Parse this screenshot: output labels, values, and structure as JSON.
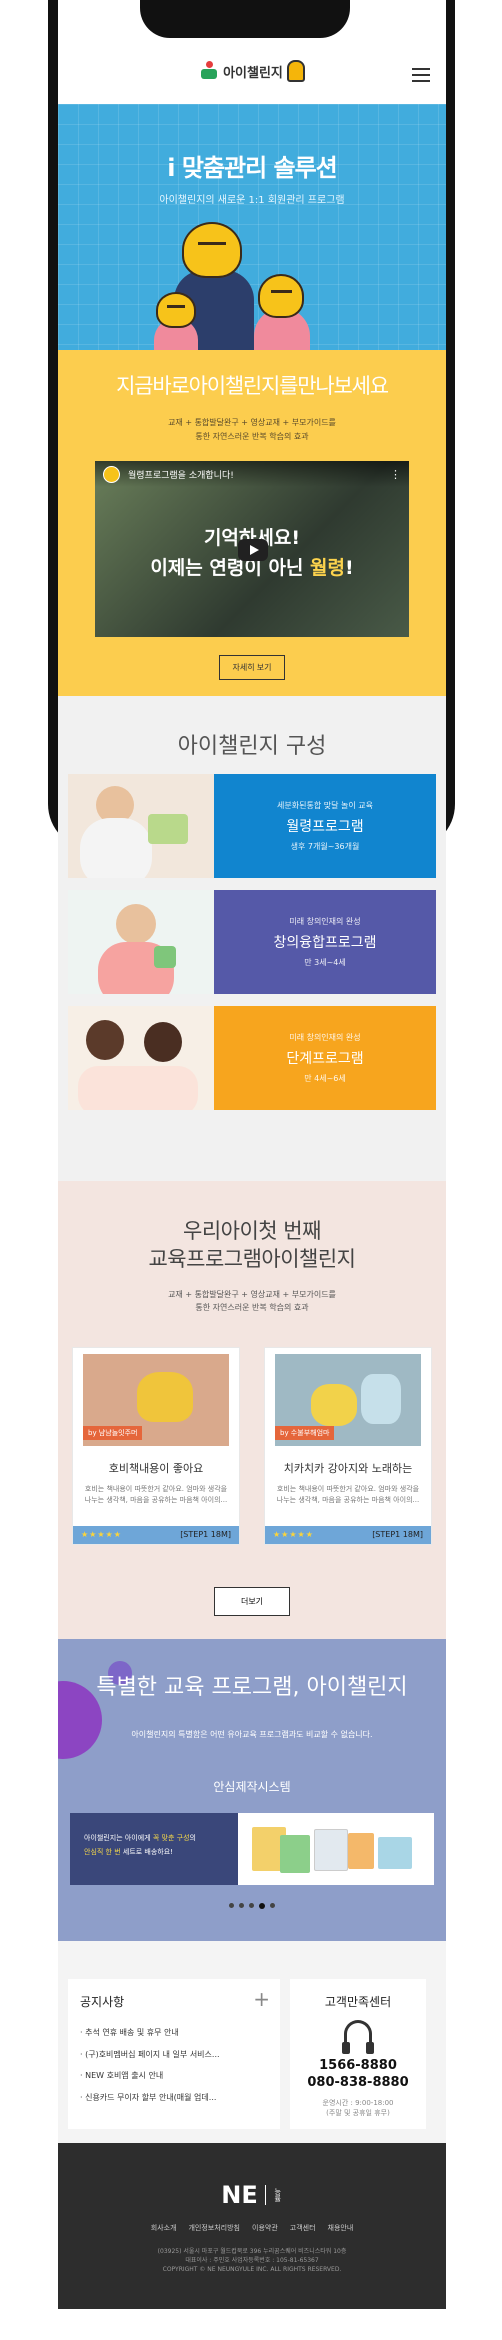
{
  "header": {
    "logo_text": "아이챌린지"
  },
  "hero": {
    "title": "i 맞춤관리 솔루션",
    "subtitle": "아이챌린지의 새로운 1:1 회원관리 프로그램"
  },
  "intro": {
    "title": "지금바로아이챌린지를만나보세요",
    "sub_line1": "교재 + 통합발달완구 + 영상교재 + 부모가이드를",
    "sub_line2": "통한 자연스러운 반복 학습의 효과",
    "video": {
      "title": "월령프로그램을 소개합니다!",
      "line1": "기억하세요!",
      "line2_prefix": "이제는 연령이 아닌 ",
      "line2_highlight": "월령",
      "line2_suffix": "!"
    },
    "detail_button": "자세히 보기"
  },
  "composition": {
    "title": "아이챌린지 구성",
    "programs": [
      {
        "small": "세분화된통합 맞달 놀이 교육",
        "name": "월령프로그램",
        "age": "생후 7개월~36개월",
        "color": "#1185cf"
      },
      {
        "small": "미래 창의인재의 완성",
        "name": "창의융합프로그램",
        "age": "만 3세~4세",
        "color": "#5559a8"
      },
      {
        "small": "미래 창의인재의 완성",
        "name": "단계프로그램",
        "age": "만 4세~6세",
        "color": "#f7a51e"
      }
    ]
  },
  "first_program": {
    "title_line1": "우리아이첫 번째",
    "title_line2": "교육프로그램아이챌린지",
    "sub_line1": "교재 + 통합발달완구 + 영상교재 + 부모가이드를",
    "sub_line2": "통한 자연스러운 반복 학습의 효과",
    "cards": [
      {
        "tag": "by 냠냠놀잇주머",
        "title": "호비책내용이 좋아요",
        "desc": "호비는 책내용이 따뜻한거 같아요. 엄마와 생각을 나누는 생각책, 마음을 공유하는 마음책 아이의...",
        "stars": "★★★★★",
        "step": "[STEP1 18M]"
      },
      {
        "tag": "by 수불부해엄마",
        "title": "치카치카 강아지와 노래하는",
        "desc": "호비는 책내용이 따뜻한거 같아요. 엄마와 생각을 나누는 생각책, 마음을 공유하는 마음책 아이의...",
        "stars": "★★★★★",
        "step": "[STEP1 18M]"
      }
    ],
    "more_button": "더보기"
  },
  "special": {
    "title": "특별한 교육 프로그램, 아이챌린지",
    "sub": "아이챌린지의 특별함은 어떤 유아교육 프로그램과도 비교할 수 없습니다.",
    "system_title": "안심제작시스템",
    "banner_line1_prefix": "아이챌린지는 아이에게 ",
    "banner_line1_highlight": "꼭 맞춘 구성",
    "banner_line1_suffix": "의",
    "banner_line2_highlight": "안심직 한 번",
    "banner_line2_suffix": " 세트로 배송하요!"
  },
  "notice": {
    "title": "공지사항",
    "items": [
      "· 추석 연휴 배송 및 휴무 안내",
      "· (구)호비멤버십 페이지 내 일부 서비스...",
      "· NEW 호비앱 출시 안내",
      "· 신용카드 무이자 할부 안내(매월 업데..."
    ]
  },
  "customer_center": {
    "title": "고객만족센터",
    "phone1": "1566-8880",
    "phone2": "080-838-8880",
    "hours1": "운영시간 : 9:00-18:00",
    "hours2": "(주말 및 공휴일 휴무)"
  },
  "footer": {
    "logo": "NE",
    "brand": "능률",
    "links": [
      "회사소개",
      "개인정보처리방침",
      "이용약관",
      "고객센터",
      "채용안내"
    ],
    "address": "(03925) 서울시 마포구 월드컵북로 396 누리꿈스퀘어 비즈니스타워 10층",
    "business": "대표이사 : 주민호 사업자등록번호 : 105-81-65367",
    "copyright": "COPYRIGHT © NE NEUNGYULE INC. ALL RIGHTS RESERVED."
  }
}
